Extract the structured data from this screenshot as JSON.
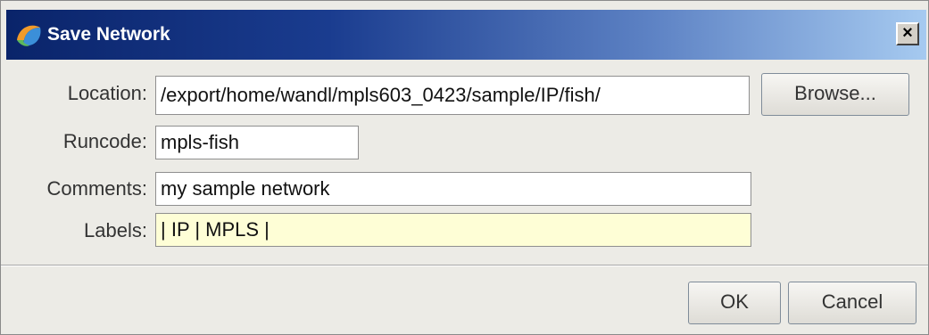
{
  "window": {
    "title": "Save Network",
    "close_glyph": "×"
  },
  "form": {
    "location_label": "Location:",
    "location_value": "/export/home/wandl/mpls603_0423/sample/IP/fish/",
    "browse_label": "Browse...",
    "runcode_label": "Runcode:",
    "runcode_value": "mpls-fish",
    "comments_label": "Comments:",
    "comments_value": "my sample network",
    "labels_label": "Labels:",
    "labels_value": "| IP | MPLS |"
  },
  "footer": {
    "ok_label": "OK",
    "cancel_label": "Cancel"
  },
  "colors": {
    "titlebar_start": "#0a246a",
    "titlebar_end": "#a6caf0",
    "dialog_bg": "#ecebe6",
    "labels_field_bg": "#fefed6"
  },
  "icons": {
    "title_icon": "app-logo-icon",
    "close_icon": "close-icon"
  }
}
